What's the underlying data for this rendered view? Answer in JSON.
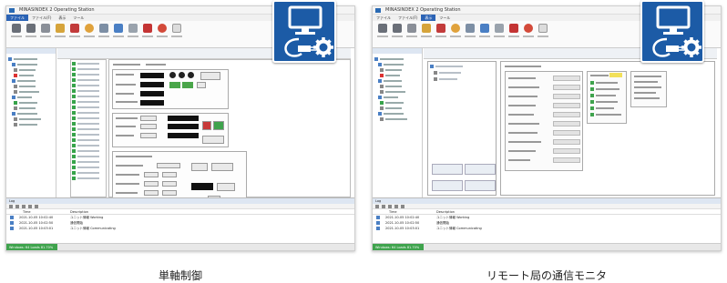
{
  "panels": [
    {
      "window_title": "MINASINDEX 2 Operating Station",
      "menu": [
        "ファイル",
        "ファイル(F)",
        "表示",
        "ツール"
      ],
      "statusbar": "Windows: 64 Loads 81.70%",
      "log_header": "Log",
      "log_columns": [
        "Time",
        "Description"
      ],
      "log_rows": [
        {
          "time": "2021-10-05 10:02:40",
          "desc": "ユニット情報 Working"
        },
        {
          "time": "2021-10-05 10:02:50",
          "desc": "通信開始"
        },
        {
          "time": "2021-10-05 10:03:01",
          "desc": "ユニット情報 Communicating"
        }
      ],
      "caption": "単軸制御"
    },
    {
      "window_title": "MINASINDEX 2 Operating Station",
      "menu": [
        "ファイル",
        "ファイル(F)",
        "表示",
        "ツール"
      ],
      "statusbar": "Windows: 64 Loads 81.70%",
      "log_header": "Log",
      "log_columns": [
        "Time",
        "Description"
      ],
      "log_rows": [
        {
          "time": "2021-10-05 10:02:40",
          "desc": "ユニット情報 Working"
        },
        {
          "time": "2021-10-05 10:02:50",
          "desc": "通信開始"
        },
        {
          "time": "2021-10-05 10:03:01",
          "desc": "ユニット情報 Communicating"
        }
      ],
      "caption": "リモート局の通信モニタ"
    }
  ],
  "badge_icon": "monitor-gear-icon",
  "colors": {
    "badge": "#1c5ba6",
    "accent": "#2b63b5",
    "status_green": "#3fa34d"
  }
}
